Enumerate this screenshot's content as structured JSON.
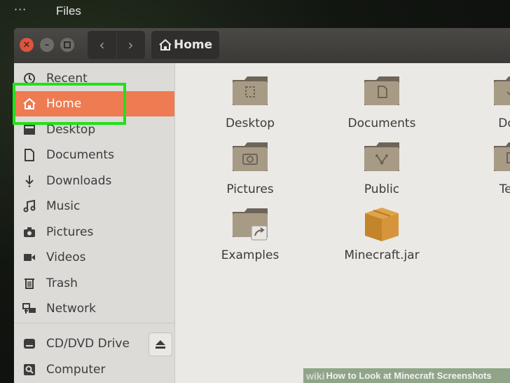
{
  "topbar": {
    "menu_dots": "···",
    "app_name": "Files"
  },
  "window": {
    "path_label": "Home",
    "colors": {
      "accent": "#ee7b52",
      "highlight_box": "#22e01a",
      "header": "#3a3936"
    }
  },
  "sidebar": {
    "items": [
      {
        "label": "Recent",
        "icon": "clock-icon"
      },
      {
        "label": "Home",
        "icon": "home-icon",
        "active": true
      },
      {
        "label": "Desktop",
        "icon": "desktop-icon"
      },
      {
        "label": "Documents",
        "icon": "document-icon"
      },
      {
        "label": "Downloads",
        "icon": "download-icon"
      },
      {
        "label": "Music",
        "icon": "music-icon"
      },
      {
        "label": "Pictures",
        "icon": "camera-icon"
      },
      {
        "label": "Videos",
        "icon": "video-icon"
      },
      {
        "label": "Trash",
        "icon": "trash-icon"
      },
      {
        "label": "Network",
        "icon": "network-icon"
      }
    ],
    "devices": [
      {
        "label": "CD/DVD Drive",
        "icon": "disc-icon"
      },
      {
        "label": "Computer",
        "icon": "computer-icon"
      }
    ]
  },
  "files": [
    {
      "label": "Desktop",
      "icon": "folder-desktop-icon"
    },
    {
      "label": "Documents",
      "icon": "folder-documents-icon"
    },
    {
      "label": "Dow",
      "icon": "folder-downloads-icon"
    },
    {
      "label": "Pictures",
      "icon": "folder-pictures-icon"
    },
    {
      "label": "Public",
      "icon": "folder-public-icon"
    },
    {
      "label": "Tem",
      "icon": "folder-templates-icon"
    },
    {
      "label": "Examples",
      "icon": "folder-link-icon"
    },
    {
      "label": "Minecraft.jar",
      "icon": "package-icon"
    }
  ],
  "watermark": {
    "brand": "wiki",
    "text": "How to Look at Minecraft Screenshots"
  }
}
